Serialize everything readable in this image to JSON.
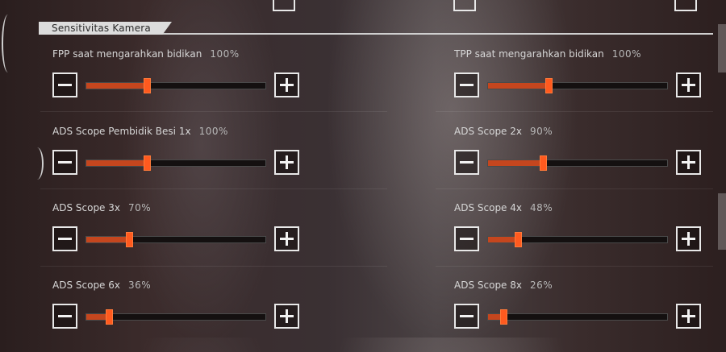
{
  "section": {
    "title": "Sensitivitas Kamera"
  },
  "settings": [
    {
      "label": "FPP saat mengarahkan bidikan",
      "value": "100%",
      "level": 0.34
    },
    {
      "label": "TPP saat mengarahkan bidikan",
      "value": "100%",
      "level": 0.34
    },
    {
      "label": "ADS Scope Pembidik Besi 1x",
      "value": "100%",
      "level": 0.34
    },
    {
      "label": "ADS Scope 2x",
      "value": "90%",
      "level": 0.31
    },
    {
      "label": "ADS Scope 3x",
      "value": "70%",
      "level": 0.24
    },
    {
      "label": "ADS Scope 4x",
      "value": "48%",
      "level": 0.17
    },
    {
      "label": "ADS Scope 6x",
      "value": "36%",
      "level": 0.13
    },
    {
      "label": "ADS Scope 8x",
      "value": "26%",
      "level": 0.09
    }
  ],
  "colors": {
    "accent": "#ff5a1f",
    "fill": "#c5461e",
    "track": "#141010",
    "text": "#d7d7d7"
  },
  "icons": {
    "decrease": "minus-icon",
    "increase": "plus-icon"
  }
}
